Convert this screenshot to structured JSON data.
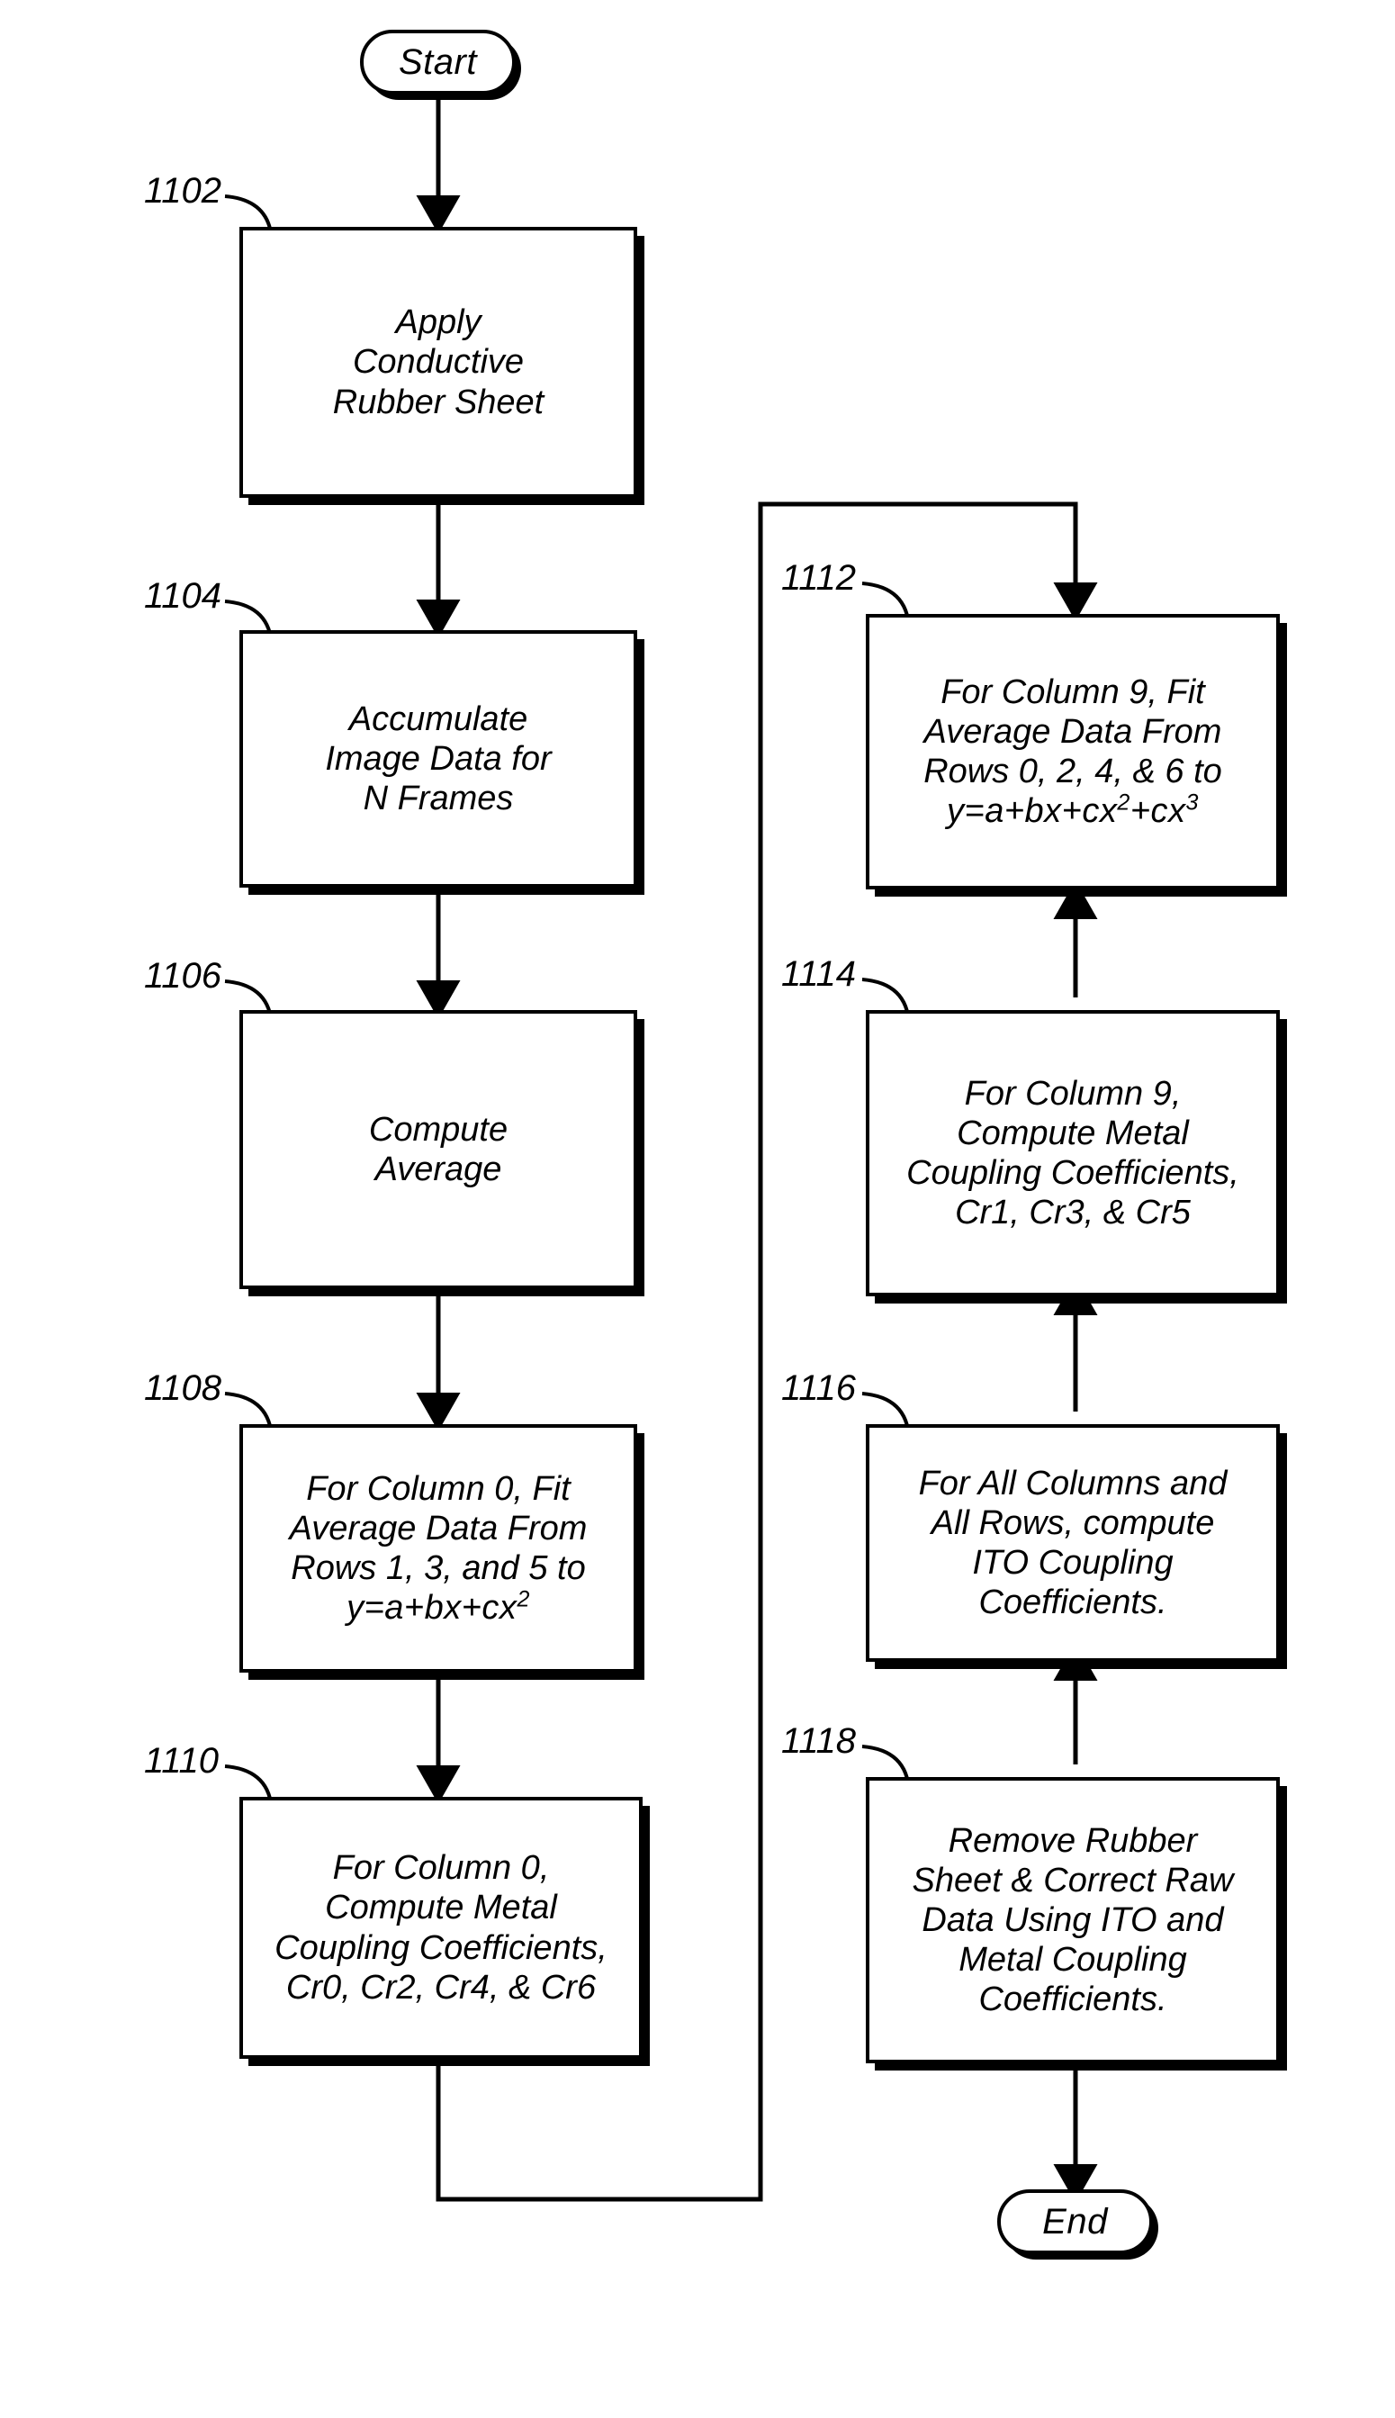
{
  "figure": {
    "type": "patent-flowchart",
    "orientation": "two-column"
  },
  "terminators": {
    "start": "Start",
    "end": "End"
  },
  "nodes": [
    {
      "ref": "1102",
      "lines": "Apply\nConductive\nRubber Sheet",
      "formula": ""
    },
    {
      "ref": "1104",
      "lines": "Accumulate\nImage Data for\nN Frames",
      "formula": ""
    },
    {
      "ref": "1106",
      "lines": "Compute\nAverage",
      "formula": ""
    },
    {
      "ref": "1108",
      "lines": "For Column 0, Fit\nAverage Data From\nRows 1, 3, and 5 to",
      "formula": "y=a+bx+cx",
      "formula_sup": "2",
      "formula_tail": "",
      "formula_sup2": ""
    },
    {
      "ref": "1110",
      "lines": "For Column 0,\nCompute Metal\nCoupling Coefficients,\nCr0, Cr2, Cr4, & Cr6",
      "formula": ""
    },
    {
      "ref": "1112",
      "lines": "For Column 9, Fit\nAverage Data From\nRows 0, 2, 4, & 6 to",
      "formula": "y=a+bx+cx",
      "formula_sup": "2",
      "formula_tail": "+cx",
      "formula_sup2": "3"
    },
    {
      "ref": "1114",
      "lines": "For Column 9,\nCompute Metal\nCoupling Coefficients,\nCr1, Cr3, & Cr5",
      "formula": ""
    },
    {
      "ref": "1116",
      "lines": "For All Columns and\nAll Rows, compute\nITO Coupling\nCoefficients.",
      "formula": ""
    },
    {
      "ref": "1118",
      "lines": "Remove Rubber\nSheet & Correct Raw\nData Using ITO and\nMetal Coupling\nCoefficients.",
      "formula": ""
    }
  ]
}
